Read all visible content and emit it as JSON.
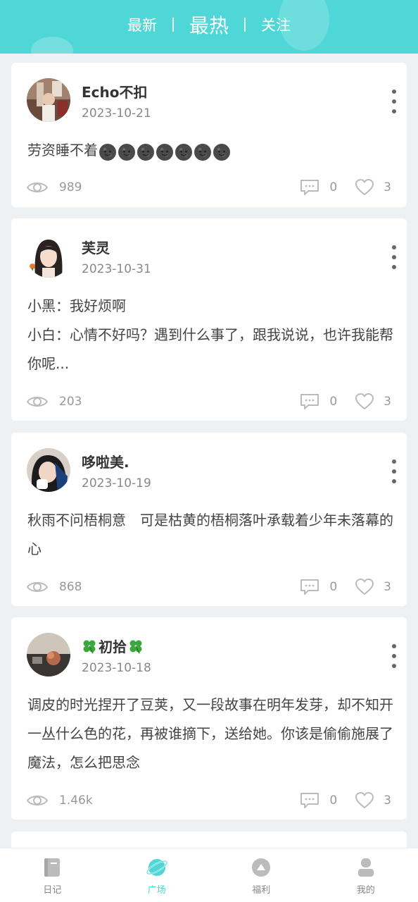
{
  "header": {
    "tabs": [
      {
        "label": "最新",
        "active": false
      },
      {
        "label": "最热",
        "active": true
      },
      {
        "label": "关注",
        "active": false
      }
    ],
    "bg_color": "#4fd6d6"
  },
  "posts": [
    {
      "name": "Echo不扣",
      "date": "2023-10-21",
      "content": "劳资睡不着",
      "content_emoji": "new-moon-face-icon",
      "emoji_count": 7,
      "views": "989",
      "comments": "0",
      "likes": "3"
    },
    {
      "name": "芙灵",
      "date": "2023-10-31",
      "content": "小黑：我好烦啊\n小白：心情不好吗？遇到什么事了，跟我说说，也许我能帮你呢...",
      "views": "203",
      "comments": "0",
      "likes": "3"
    },
    {
      "name": "哆啦美.",
      "date": "2023-10-19",
      "content": "秋雨不问梧桐意　可是枯黄的梧桐落叶承载着少年未落幕的心",
      "views": "868",
      "comments": "0",
      "likes": "3"
    },
    {
      "name_prefix_icon": "four-leaf-clover-icon",
      "name": "初拾",
      "name_suffix_icon": "four-leaf-clover-icon",
      "date": "2023-10-18",
      "content": "调皮的时光捏开了豆荚，又一段故事在明年发芽，却不知开一丛什么色的花，再被谁摘下，送给她。你该是偷偷施展了魔法，怎么把思念",
      "views": "1.46k",
      "comments": "0",
      "likes": "3"
    }
  ],
  "nav": {
    "items": [
      {
        "label": "日记",
        "icon": "diary-book-icon",
        "active": false
      },
      {
        "label": "广场",
        "icon": "planet-icon",
        "active": true
      },
      {
        "label": "福利",
        "icon": "gift-up-icon",
        "active": false
      },
      {
        "label": "我的",
        "icon": "user-profile-icon",
        "active": false
      }
    ],
    "active_color": "#4fd6d6",
    "inactive_color": "#bbbbbb"
  }
}
